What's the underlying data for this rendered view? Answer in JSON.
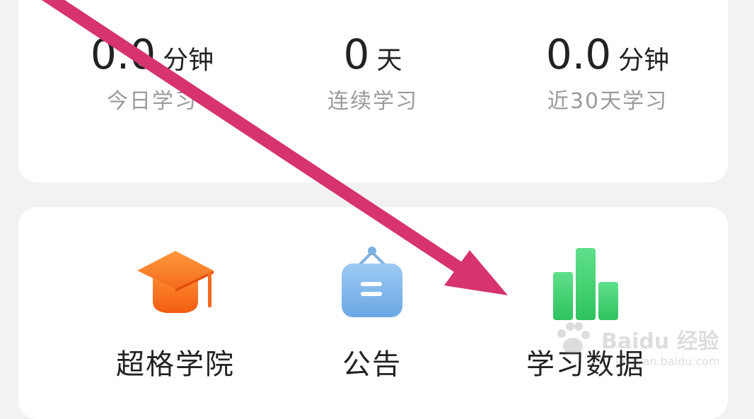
{
  "stats": [
    {
      "value": "0.0",
      "unit": "分钟",
      "label": "今日学习"
    },
    {
      "value": "0",
      "unit": "天",
      "label": "连续学习"
    },
    {
      "value": "0.0",
      "unit": "分钟",
      "label": "近30天学习"
    }
  ],
  "menu": [
    {
      "label": "超格学院",
      "icon": "graduation-cap-icon",
      "color": "#f5772c"
    },
    {
      "label": "公告",
      "icon": "notice-board-icon",
      "color": "#7fb6e8"
    },
    {
      "label": "学习数据",
      "icon": "bar-chart-icon",
      "color": "#3fcf6c"
    }
  ],
  "watermark": {
    "brand": "Baidu 经验",
    "url": "jingyan.baidu.com"
  },
  "colors": {
    "background": "#f2f2f2",
    "card": "#ffffff",
    "arrow": "#d6336f",
    "text_primary": "#222222",
    "text_secondary": "#9a9a9a"
  }
}
